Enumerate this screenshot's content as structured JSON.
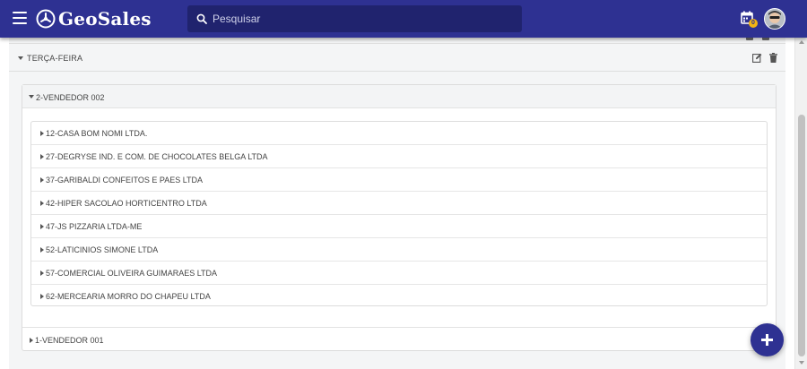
{
  "app": {
    "name": "GeoSales",
    "brand_color": "#2e3192",
    "accent_color": "#f2b413"
  },
  "header": {
    "search_placeholder": "Pesquisar",
    "calendar_badge": "0",
    "icons": [
      "menu-icon",
      "logo-icon",
      "search-icon",
      "calendar-icon",
      "avatar"
    ]
  },
  "day": {
    "title": "TERÇA-FEIRA",
    "actions": [
      "edit-icon",
      "trash-icon"
    ]
  },
  "vendors": [
    {
      "title": "2-VENDEDOR 002",
      "expanded": true,
      "clients": [
        "12-CASA BOM NOMI LTDA.",
        "27-DEGRYSE IND. E COM. DE CHOCOLATES BELGA LTDA",
        "37-GARIBALDI CONFEITOS E PAES LTDA",
        "42-HIPER SACOLAO HORTICENTRO LTDA",
        "47-JS PIZZARIA LTDA-ME",
        "52-LATICINIOS SIMONE LTDA",
        "57-COMERCIAL OLIVEIRA GUIMARAES LTDA",
        "62-MERCEARIA MORRO DO CHAPEU LTDA"
      ]
    },
    {
      "title": "1-VENDEDOR 001",
      "expanded": false,
      "clients": []
    }
  ],
  "fab": {
    "icon": "plus-icon"
  }
}
